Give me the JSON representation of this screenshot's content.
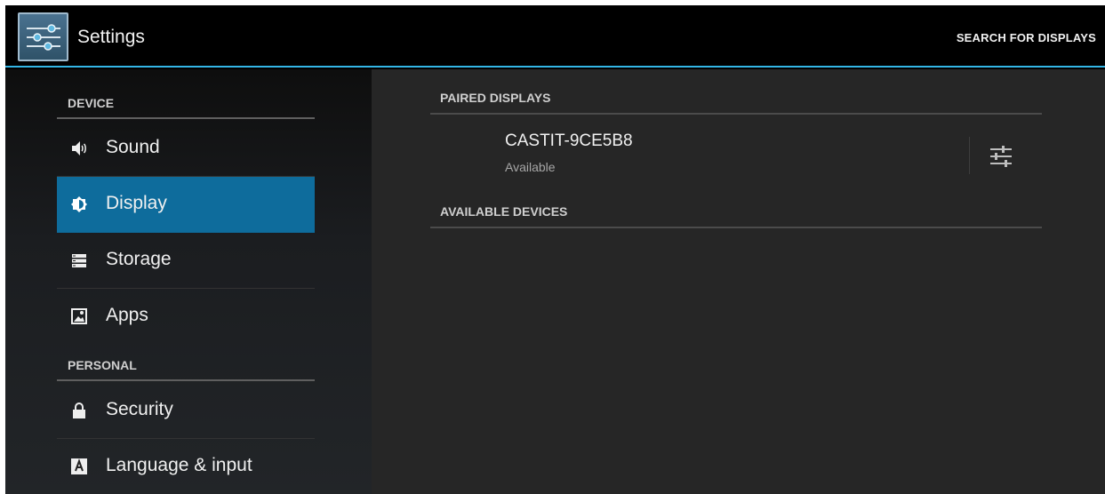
{
  "actionbar": {
    "title": "Settings",
    "search_label": "SEARCH FOR DISPLAYS",
    "accent_color": "#33b5e5"
  },
  "sidebar": {
    "sections": [
      {
        "header": "DEVICE",
        "items": [
          {
            "label": "Sound",
            "icon": "speaker-icon",
            "selected": false
          },
          {
            "label": "Display",
            "icon": "brightness-icon",
            "selected": true
          },
          {
            "label": "Storage",
            "icon": "storage-icon",
            "selected": false
          },
          {
            "label": "Apps",
            "icon": "apps-icon",
            "selected": false
          }
        ]
      },
      {
        "header": "PERSONAL",
        "items": [
          {
            "label": "Security",
            "icon": "lock-icon",
            "selected": false
          },
          {
            "label": "Language & input",
            "icon": "keyboard-a-icon",
            "selected": false
          }
        ]
      }
    ],
    "selected_color": "#0e6c9c"
  },
  "main": {
    "paired_header": "PAIRED DISPLAYS",
    "paired_devices": [
      {
        "name": "CASTIT-9CE5B8",
        "status": "Available",
        "icon": "sliders-icon"
      }
    ],
    "available_header": "AVAILABLE DEVICES"
  }
}
